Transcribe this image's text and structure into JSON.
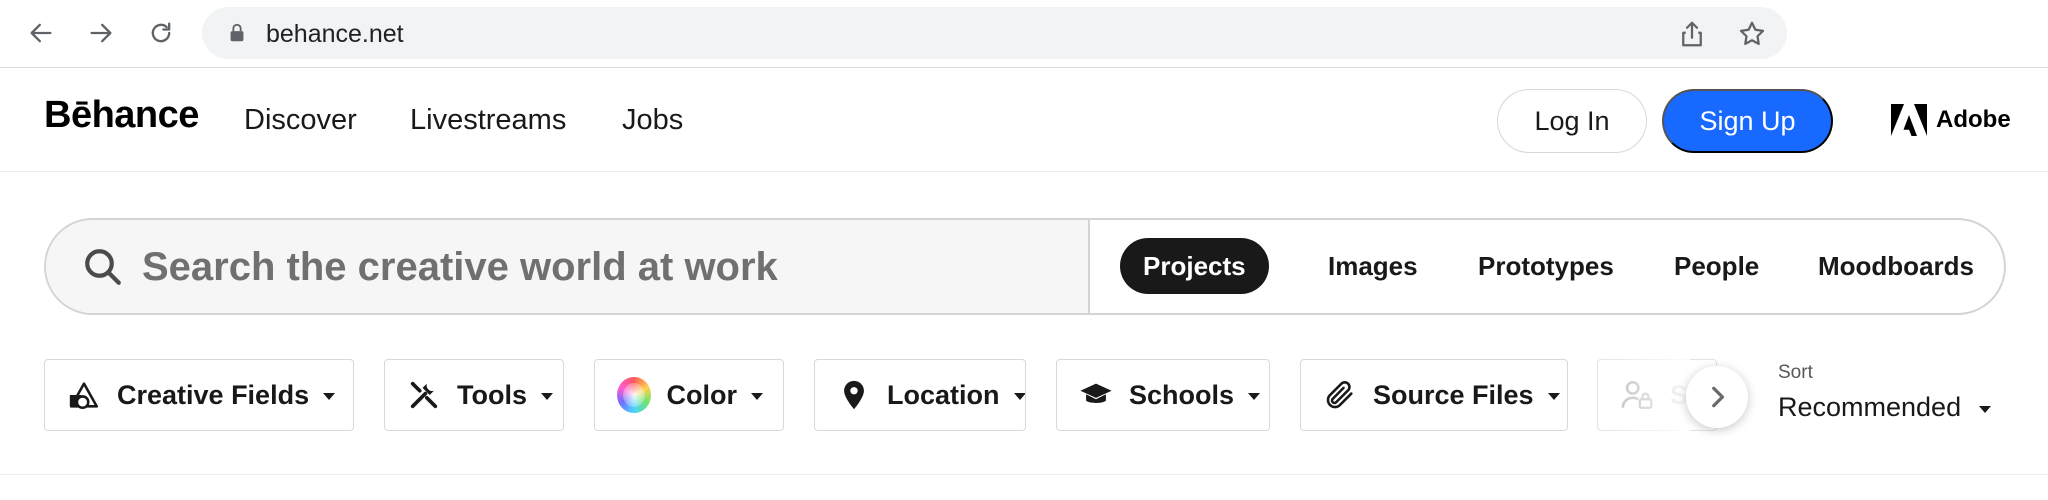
{
  "browser": {
    "url": "behance.net",
    "icons": [
      "back-arrow-icon",
      "forward-arrow-icon",
      "reload-icon",
      "lock-icon",
      "share-icon",
      "bookmark-star-icon"
    ]
  },
  "header": {
    "logo": "Bēhance",
    "nav": [
      "Discover",
      "Livestreams",
      "Jobs"
    ],
    "login_label": "Log In",
    "signup_label": "Sign Up",
    "adobe_label": "Adobe"
  },
  "search": {
    "placeholder": "Search the creative world at work",
    "tabs": [
      "Projects",
      "Images",
      "Prototypes",
      "People",
      "Moodboards"
    ],
    "active_tab": "Projects"
  },
  "filters": [
    {
      "label": "Creative Fields",
      "icon": "creative-fields-icon"
    },
    {
      "label": "Tools",
      "icon": "tools-icon"
    },
    {
      "label": "Color",
      "icon": "color-wheel-icon"
    },
    {
      "label": "Location",
      "icon": "location-pin-icon"
    },
    {
      "label": "Schools",
      "icon": "graduation-cap-icon"
    },
    {
      "label": "Source Files",
      "icon": "paperclip-icon"
    },
    {
      "label": "S",
      "icon": "subscription-user-lock-icon"
    }
  ],
  "sort": {
    "label": "Sort",
    "value": "Recommended"
  },
  "colors": {
    "brand_blue": "#1769ff",
    "active_tab_bg": "#191919",
    "text": "#191919"
  }
}
